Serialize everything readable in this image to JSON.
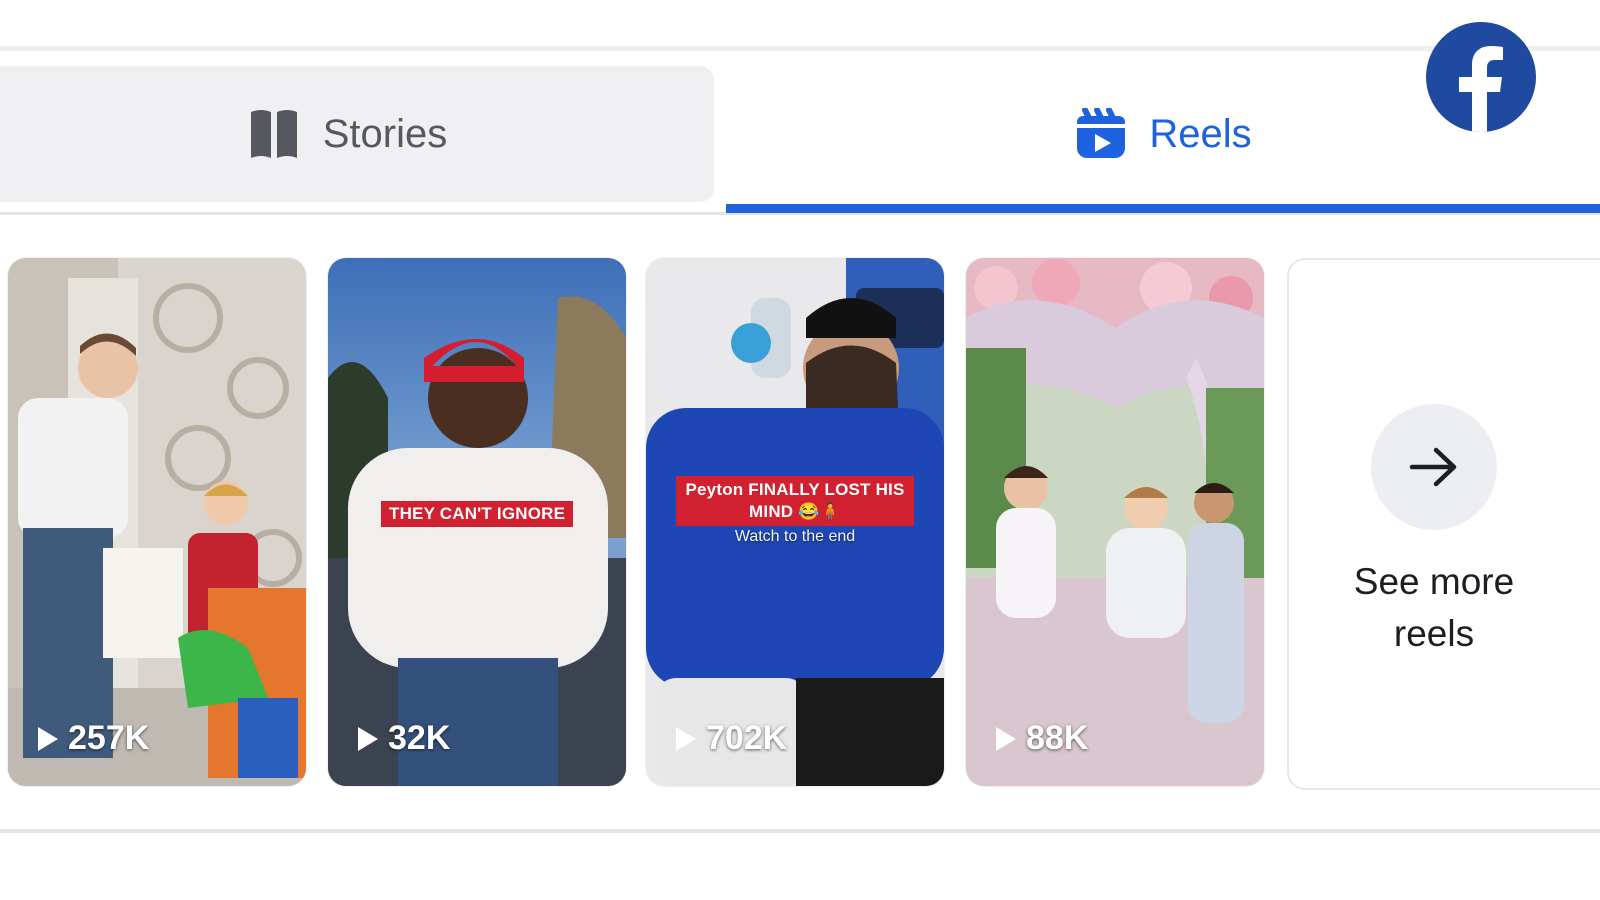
{
  "brand": {
    "logo": "facebook-logo",
    "color": "#1f4aa0"
  },
  "tabs": [
    {
      "label": "Stories",
      "icon": "book-icon",
      "active": false
    },
    {
      "label": "Reels",
      "icon": "reels-icon",
      "active": true
    }
  ],
  "colors": {
    "accent": "#1f62e0",
    "inactive_text": "#55595f",
    "caption_red": "#d1202f"
  },
  "reels": [
    {
      "views": "257K",
      "caption": "",
      "subcaption": ""
    },
    {
      "views": "32K",
      "caption": "THEY CAN'T IGNORE",
      "subcaption": ""
    },
    {
      "views": "702K",
      "caption": "Peyton FINALLY LOST HIS MIND 😂🧍",
      "subcaption": "Watch to the end"
    },
    {
      "views": "88K",
      "caption": "",
      "subcaption": ""
    }
  ],
  "see_more": {
    "label": "See more\nreels",
    "icon": "arrow-right-icon"
  }
}
